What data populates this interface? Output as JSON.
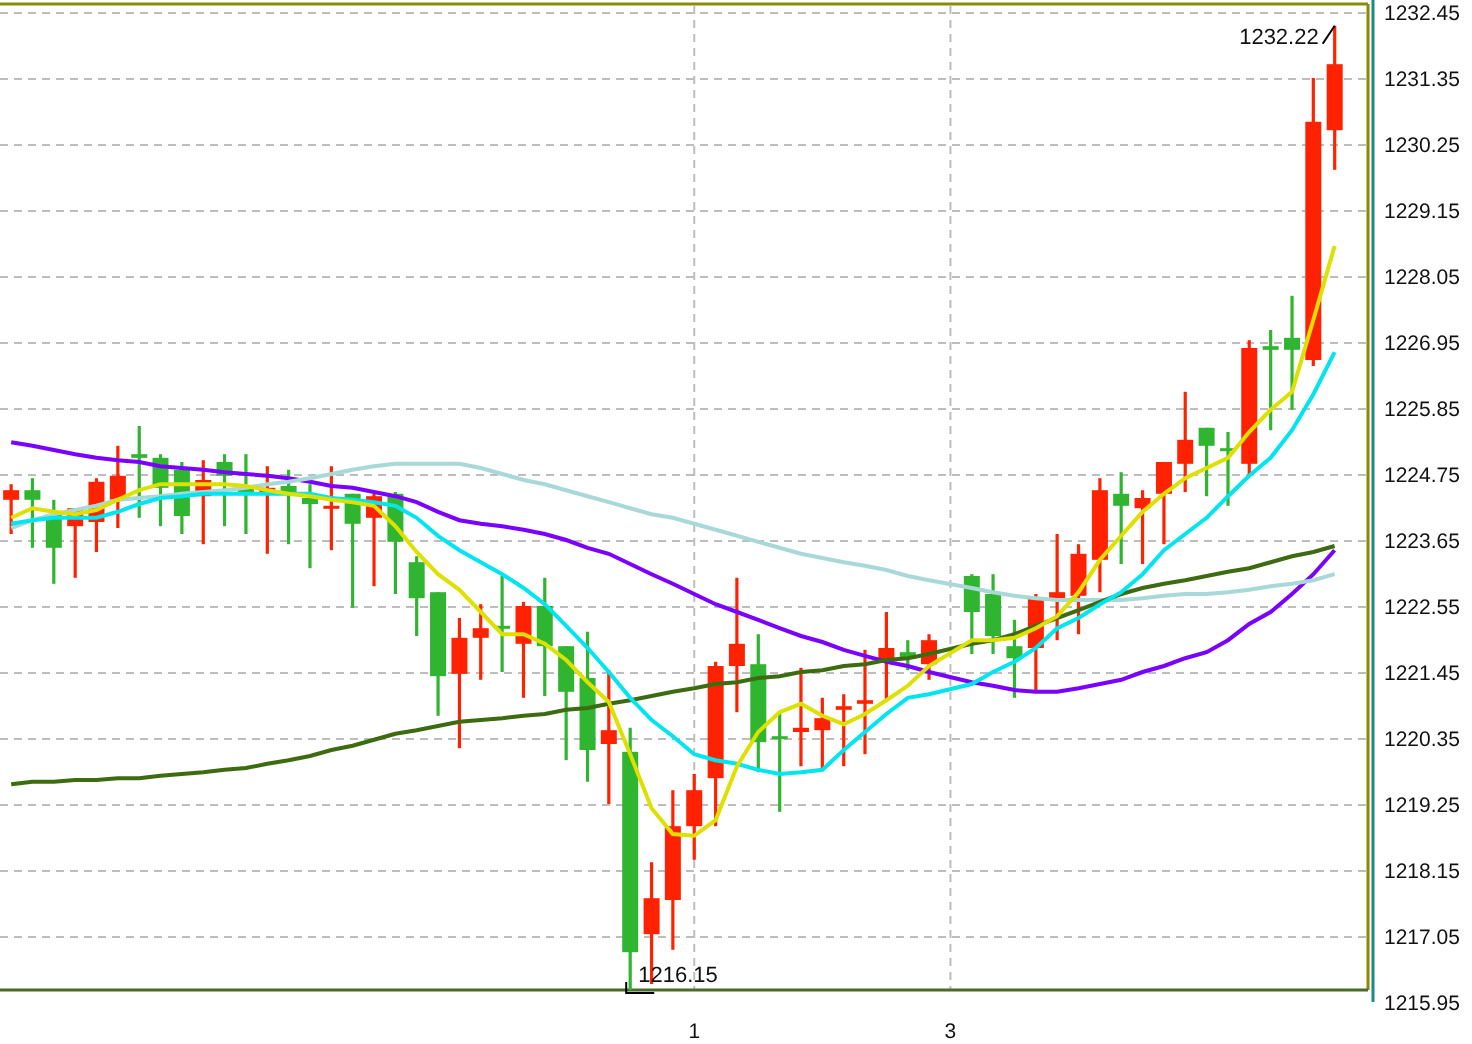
{
  "chart": {
    "chart_data": {
      "type": "candlestick",
      "grid": true,
      "ylim": [
        1215.95,
        1232.65
      ],
      "yticks": [
        1232.45,
        1231.35,
        1230.25,
        1229.15,
        1228.05,
        1226.95,
        1225.85,
        1224.75,
        1223.65,
        1222.55,
        1221.45,
        1220.35,
        1219.25,
        1218.15,
        1217.05,
        1215.95
      ],
      "x": [
        -4.333,
        -4.167,
        -4,
        -3.833,
        -3.667,
        -3.5,
        -3.333,
        -3.167,
        -3,
        -2.833,
        -2.667,
        -2.5,
        -2.333,
        -2.167,
        -2,
        -1.833,
        -1.667,
        -1.5,
        -1.333,
        -1.167,
        -1,
        -0.833,
        -0.667,
        -0.5,
        -0.333,
        -0.167,
        0,
        0.167,
        0.333,
        0.5,
        0.667,
        0.833,
        1,
        1.167,
        1.333,
        1.5,
        1.667,
        1.833,
        2,
        2.167,
        2.333,
        2.5,
        2.667,
        2.833,
        3.167,
        3.333,
        3.5,
        3.667,
        3.833,
        4,
        4.167,
        4.333,
        4.5,
        4.667,
        4.833,
        5,
        5.167,
        5.333,
        5.5,
        5.667,
        5.833,
        6
      ],
      "xlim": [
        -4.42,
        6.26
      ],
      "xticks": [
        1,
        3
      ],
      "ohlc": [
        [
          1224.32,
          1224.58,
          1223.75,
          1224.48
        ],
        [
          1224.48,
          1224.68,
          1223.52,
          1224.32
        ],
        [
          1224.08,
          1224.32,
          1222.92,
          1223.52
        ],
        [
          1223.88,
          1224.18,
          1223.02,
          1224.18
        ],
        [
          1223.95,
          1224.68,
          1223.45,
          1224.62
        ],
        [
          1224.32,
          1225.22,
          1223.85,
          1224.72
        ],
        [
          1225.08,
          1225.55,
          1224.02,
          1225.02
        ],
        [
          1225.02,
          1225.08,
          1223.88,
          1224.52
        ],
        [
          1224.82,
          1224.95,
          1223.75,
          1224.05
        ],
        [
          1224.38,
          1224.98,
          1223.58,
          1224.65
        ],
        [
          1224.95,
          1225.08,
          1223.88,
          1224.72
        ],
        [
          1224.52,
          1225.08,
          1223.75,
          1224.45
        ],
        [
          1224.45,
          1224.88,
          1223.42,
          1224.52
        ],
        [
          1224.55,
          1224.82,
          1223.58,
          1224.45
        ],
        [
          1224.35,
          1224.58,
          1223.18,
          1224.25
        ],
        [
          1224.2,
          1224.88,
          1223.48,
          1224.22
        ],
        [
          1224.42,
          1224.42,
          1222.52,
          1223.92
        ],
        [
          1224.02,
          1224.42,
          1222.88,
          1224.38
        ],
        [
          1224.42,
          1224.45,
          1222.75,
          1223.62
        ],
        [
          1223.28,
          1223.38,
          1222.05,
          1222.68
        ],
        [
          1222.78,
          1222.78,
          1220.72,
          1221.38
        ],
        [
          1221.42,
          1222.35,
          1220.18,
          1222.02
        ],
        [
          1222.02,
          1222.58,
          1221.32,
          1222.18
        ],
        [
          1222.22,
          1223.05,
          1221.45,
          1222.18
        ],
        [
          1221.92,
          1222.62,
          1221.02,
          1222.55
        ],
        [
          1222.55,
          1223.02,
          1221.05,
          1221.88
        ],
        [
          1221.88,
          1221.88,
          1219.98,
          1221.12
        ],
        [
          1221.35,
          1222.12,
          1219.62,
          1220.15
        ],
        [
          1220.25,
          1221.48,
          1219.25,
          1220.48
        ],
        [
          1220.12,
          1220.52,
          1216.15,
          1216.78
        ],
        [
          1217.08,
          1218.28,
          1216.25,
          1217.68
        ],
        [
          1217.65,
          1219.48,
          1216.82,
          1218.88
        ],
        [
          1218.88,
          1219.75,
          1218.32,
          1219.48
        ],
        [
          1219.68,
          1221.62,
          1218.88,
          1221.55
        ],
        [
          1221.55,
          1223.02,
          1220.78,
          1221.92
        ],
        [
          1221.58,
          1222.08,
          1219.78,
          1220.28
        ],
        [
          1220.38,
          1220.78,
          1219.12,
          1220.35
        ],
        [
          1220.45,
          1221.52,
          1219.88,
          1220.52
        ],
        [
          1220.48,
          1221.02,
          1219.85,
          1220.68
        ],
        [
          1220.82,
          1221.08,
          1219.88,
          1220.88
        ],
        [
          1220.92,
          1221.82,
          1220.08,
          1220.98
        ],
        [
          1221.65,
          1222.45,
          1220.98,
          1221.85
        ],
        [
          1221.78,
          1221.98,
          1221.48,
          1221.68
        ],
        [
          1221.58,
          1222.08,
          1221.32,
          1221.98
        ],
        [
          1223.05,
          1223.08,
          1221.75,
          1222.45
        ],
        [
          1222.75,
          1223.08,
          1221.75,
          1222.05
        ],
        [
          1221.88,
          1222.32,
          1221.02,
          1221.68
        ],
        [
          1221.85,
          1222.75,
          1221.12,
          1222.68
        ],
        [
          1222.65,
          1223.75,
          1221.98,
          1222.78
        ],
        [
          1222.72,
          1223.58,
          1222.08,
          1223.42
        ],
        [
          1223.32,
          1224.68,
          1222.78,
          1224.48
        ],
        [
          1224.42,
          1224.78,
          1223.25,
          1224.22
        ],
        [
          1224.18,
          1224.48,
          1223.25,
          1224.35
        ],
        [
          1224.42,
          1224.95,
          1223.58,
          1224.95
        ],
        [
          1224.92,
          1226.12,
          1224.45,
          1225.32
        ],
        [
          1225.52,
          1225.52,
          1224.38,
          1225.22
        ],
        [
          1225.18,
          1225.45,
          1224.22,
          1225.15
        ],
        [
          1224.92,
          1226.98,
          1224.72,
          1226.85
        ],
        [
          1226.88,
          1227.15,
          1225.48,
          1226.82
        ],
        [
          1227.02,
          1227.72,
          1225.82,
          1226.82
        ],
        [
          1226.65,
          1231.35,
          1226.55,
          1230.62
        ],
        [
          1230.48,
          1232.22,
          1229.82,
          1231.58
        ]
      ],
      "series": [
        {
          "type": "line",
          "color": "#7a00ff",
          "values": [
            1225.28,
            1225.22,
            1225.15,
            1225.08,
            1225.02,
            1224.98,
            1224.95,
            1224.88,
            1224.85,
            1224.82,
            1224.78,
            1224.75,
            1224.72,
            1224.68,
            1224.62,
            1224.55,
            1224.52,
            1224.45,
            1224.38,
            1224.28,
            1224.12,
            1223.98,
            1223.92,
            1223.88,
            1223.82,
            1223.75,
            1223.65,
            1223.52,
            1223.42,
            1223.25,
            1223.08,
            1222.92,
            1222.75,
            1222.58,
            1222.45,
            1222.32,
            1222.18,
            1222.05,
            1221.95,
            1221.82,
            1221.72,
            1221.62,
            1221.55,
            1221.45,
            1221.28,
            1221.22,
            1221.15,
            1221.12,
            1221.12,
            1221.18,
            1221.25,
            1221.32,
            1221.45,
            1221.55,
            1221.68,
            1221.78,
            1221.98,
            1222.25,
            1222.45,
            1222.75,
            1223.08,
            1223.48
          ]
        },
        {
          "type": "line",
          "color": "#a8d8d8",
          "values": [
            1223.85,
            1223.98,
            1224.08,
            1224.15,
            1224.22,
            1224.32,
            1224.35,
            1224.38,
            1224.42,
            1224.45,
            1224.48,
            1224.52,
            1224.58,
            1224.62,
            1224.68,
            1224.75,
            1224.82,
            1224.88,
            1224.92,
            1224.92,
            1224.92,
            1224.92,
            1224.85,
            1224.75,
            1224.65,
            1224.58,
            1224.48,
            1224.38,
            1224.28,
            1224.18,
            1224.08,
            1224.02,
            1223.92,
            1223.82,
            1223.72,
            1223.62,
            1223.52,
            1223.42,
            1223.35,
            1223.28,
            1223.22,
            1223.15,
            1223.05,
            1222.98,
            1222.85,
            1222.78,
            1222.72,
            1222.68,
            1222.65,
            1222.65,
            1222.65,
            1222.65,
            1222.68,
            1222.72,
            1222.75,
            1222.75,
            1222.78,
            1222.82,
            1222.88,
            1222.92,
            1222.98,
            1223.08
          ]
        },
        {
          "type": "line",
          "color": "#3d6b10",
          "values": [
            1219.58,
            1219.62,
            1219.62,
            1219.65,
            1219.65,
            1219.68,
            1219.68,
            1219.72,
            1219.75,
            1219.78,
            1219.82,
            1219.85,
            1219.92,
            1219.98,
            1220.05,
            1220.15,
            1220.22,
            1220.32,
            1220.42,
            1220.48,
            1220.55,
            1220.62,
            1220.65,
            1220.68,
            1220.72,
            1220.75,
            1220.82,
            1220.85,
            1220.92,
            1220.98,
            1221.05,
            1221.12,
            1221.18,
            1221.25,
            1221.28,
            1221.35,
            1221.38,
            1221.45,
            1221.48,
            1221.55,
            1221.58,
            1221.65,
            1221.68,
            1221.75,
            1221.92,
            1221.98,
            1222.08,
            1222.22,
            1222.35,
            1222.48,
            1222.62,
            1222.75,
            1222.85,
            1222.92,
            1222.98,
            1223.05,
            1223.12,
            1223.18,
            1223.28,
            1223.38,
            1223.45,
            1223.55
          ]
        },
        {
          "type": "line",
          "color": "#00e5f0",
          "values": [
            1223.92,
            1223.98,
            1224.02,
            1224.02,
            1224.02,
            1224.12,
            1224.25,
            1224.35,
            1224.38,
            1224.42,
            1224.42,
            1224.42,
            1224.42,
            1224.42,
            1224.42,
            1224.35,
            1224.32,
            1224.28,
            1224.22,
            1224.02,
            1223.72,
            1223.48,
            1223.28,
            1223.08,
            1222.85,
            1222.58,
            1222.22,
            1221.85,
            1221.45,
            1221.02,
            1220.65,
            1220.38,
            1220.08,
            1219.98,
            1219.92,
            1219.82,
            1219.75,
            1219.78,
            1219.82,
            1220.15,
            1220.45,
            1220.75,
            1221.02,
            1221.08,
            1221.25,
            1221.45,
            1221.62,
            1221.85,
            1222.18,
            1222.35,
            1222.58,
            1222.78,
            1223.08,
            1223.48,
            1223.75,
            1224.02,
            1224.38,
            1224.72,
            1225.02,
            1225.48,
            1226.08,
            1226.78
          ]
        },
        {
          "type": "line",
          "color": "#dde000",
          "values": [
            1224.02,
            1224.18,
            1224.12,
            1224.08,
            1224.15,
            1224.32,
            1224.48,
            1224.58,
            1224.58,
            1224.58,
            1224.58,
            1224.55,
            1224.48,
            1224.42,
            1224.38,
            1224.32,
            1224.28,
            1224.22,
            1223.88,
            1223.45,
            1223.08,
            1222.82,
            1222.45,
            1222.08,
            1222.08,
            1221.92,
            1221.65,
            1221.28,
            1220.95,
            1220.08,
            1219.18,
            1218.75,
            1218.72,
            1218.98,
            1219.88,
            1220.45,
            1220.78,
            1220.92,
            1220.72,
            1220.58,
            1220.75,
            1220.98,
            1221.22,
            1221.55,
            1221.98,
            1221.98,
            1222.02,
            1222.18,
            1222.38,
            1222.78,
            1223.32,
            1223.72,
            1224.12,
            1224.42,
            1224.68,
            1224.85,
            1225.02,
            1225.45,
            1225.82,
            1226.12,
            1227.32,
            1228.55
          ]
        }
      ],
      "annotations": [
        "1216.15",
        "1232.22"
      ]
    }
  }
}
